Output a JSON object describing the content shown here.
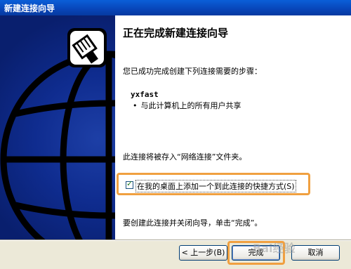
{
  "window": {
    "title": "新建连接向导"
  },
  "content": {
    "heading": "正在完成新建连接向导",
    "intro": "您已成功完成创建下列连接需要的步骤：",
    "connection_name": "yxfast",
    "bullet": "与此计算机上的所有用户共享",
    "save_note": "此连接将被存入“网络连接”文件夹。",
    "shortcut_label": "在我的桌面上添加一个到此连接的快捷方式(S)",
    "shortcut_checked": true,
    "finish_note": "要创建此连接并关闭向导，单击“完成”。"
  },
  "buttons": {
    "back": "< 上一步(B)",
    "finish": "完成",
    "cancel": "取消"
  },
  "watermark": "Bai经验"
}
